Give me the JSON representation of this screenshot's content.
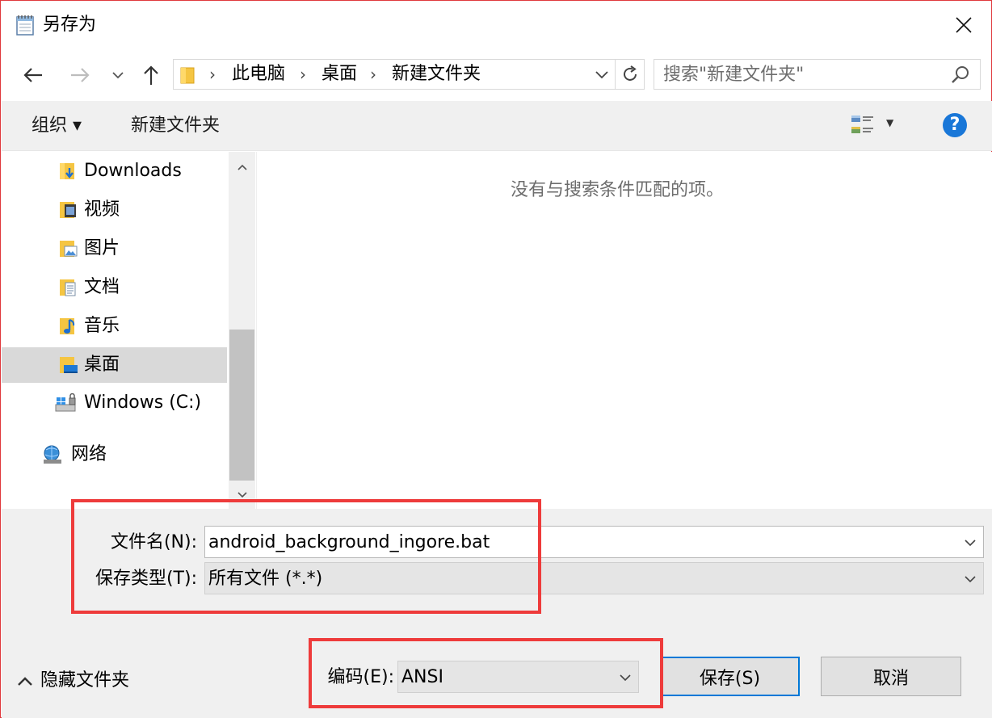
{
  "window": {
    "title": "另存为",
    "close_glyph": "✕"
  },
  "nav": {
    "back_glyph": "←",
    "forward_glyph": "→",
    "recent_glyph": "⌄",
    "up_glyph": "↑",
    "breadcrumbs": [
      "此电脑",
      "桌面",
      "新建文件夹"
    ],
    "separator": "›",
    "refresh_glyph": "↻",
    "search_placeholder": "搜索\"新建文件夹\""
  },
  "toolbar": {
    "organize_label": "组织 ▾",
    "new_folder_label": "新建文件夹",
    "help_glyph": "?"
  },
  "sidebar": {
    "items": [
      {
        "label": "Downloads",
        "icon": "downloads-folder-icon"
      },
      {
        "label": "视频",
        "icon": "videos-folder-icon"
      },
      {
        "label": "图片",
        "icon": "pictures-folder-icon"
      },
      {
        "label": "文档",
        "icon": "documents-folder-icon"
      },
      {
        "label": "音乐",
        "icon": "music-folder-icon"
      },
      {
        "label": "桌面",
        "icon": "desktop-folder-icon",
        "selected": true
      },
      {
        "label": "Windows (C:)",
        "icon": "drive-icon"
      },
      {
        "label": "网络",
        "icon": "network-icon"
      }
    ]
  },
  "content": {
    "empty_message": "没有与搜索条件匹配的项。"
  },
  "form": {
    "filename_label": "文件名(N):",
    "filename_value": "android_background_ingore.bat",
    "filetype_label": "保存类型(T):",
    "filetype_value": "所有文件  (*.*)",
    "encoding_label": "编码(E):",
    "encoding_value": "ANSI"
  },
  "buttons": {
    "save_label": "保存(S)",
    "cancel_label": "取消",
    "hide_folders_label": "隐藏文件夹"
  },
  "colors": {
    "highlight": "#ee3b3b",
    "accent": "#0078d7",
    "selected_bg": "#d9d9d9"
  }
}
